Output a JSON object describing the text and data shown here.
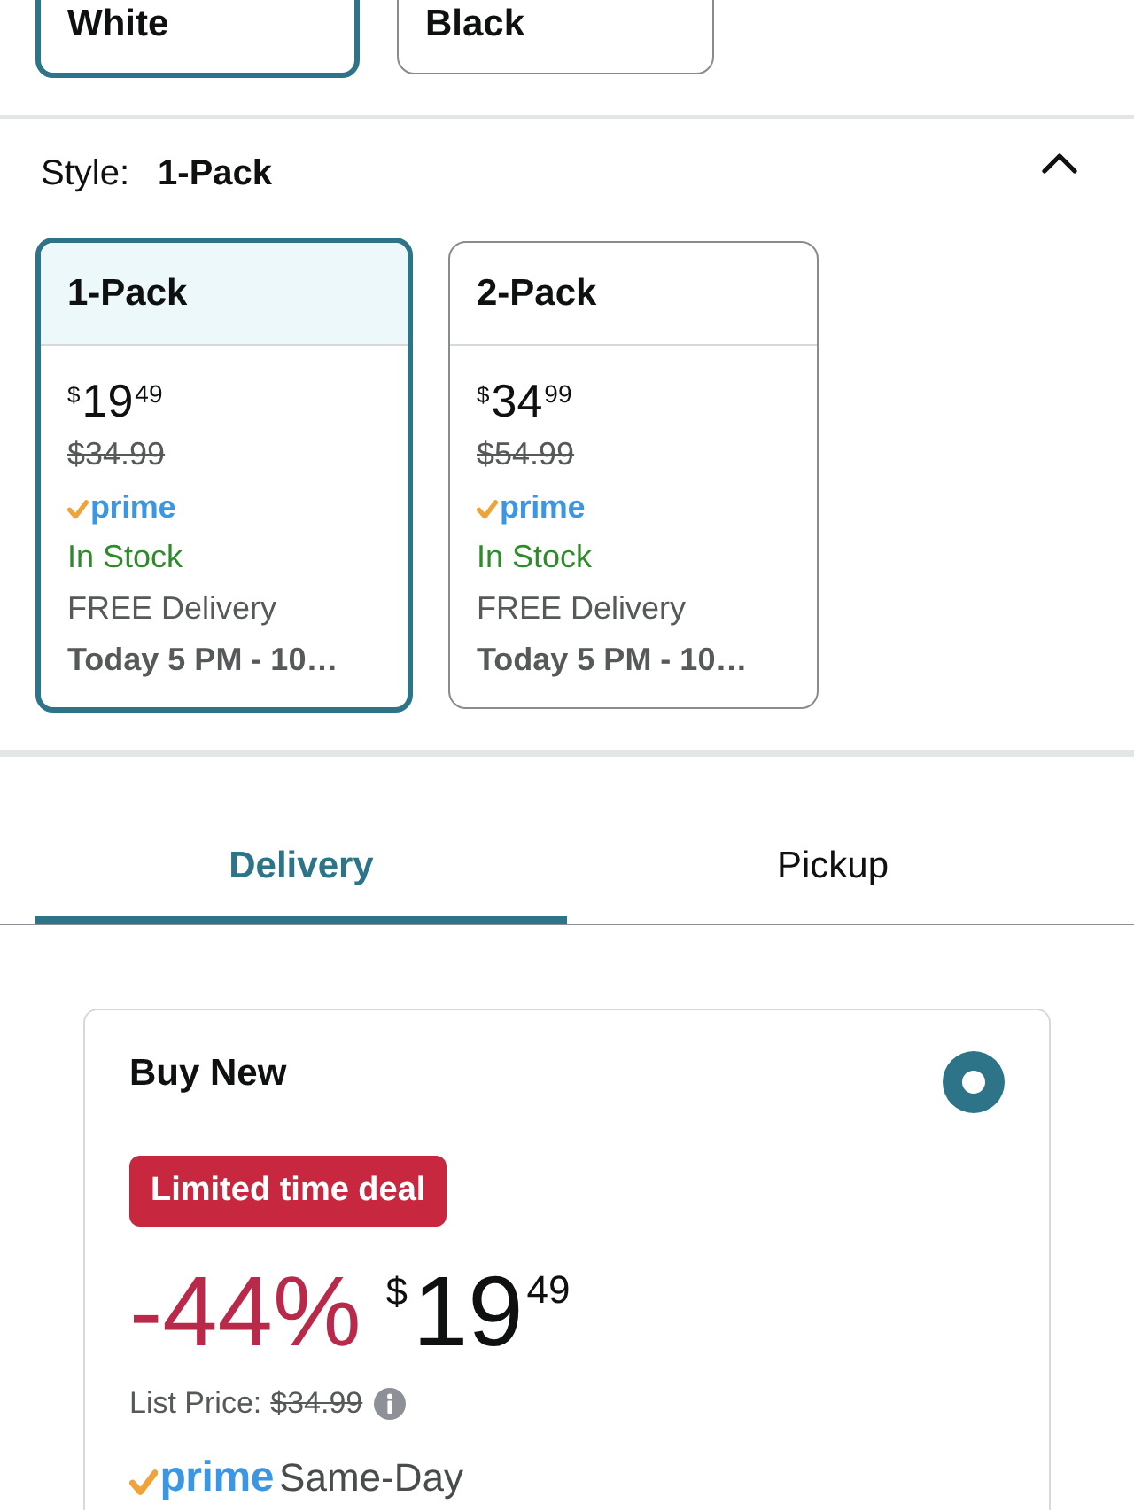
{
  "color_options": [
    {
      "label": "White",
      "selected": true
    },
    {
      "label": "Black",
      "selected": false
    }
  ],
  "style": {
    "label": "Style:",
    "value": "1-Pack",
    "expanded": true,
    "options": [
      {
        "name": "1-Pack",
        "selected": true,
        "price": {
          "currency": "$",
          "whole": "19",
          "fraction": "49"
        },
        "list_price": "$34.99",
        "prime": "prime",
        "availability": "In Stock",
        "delivery": "FREE Delivery",
        "delivery_time": "Today 5 PM - 10…"
      },
      {
        "name": "2-Pack",
        "selected": false,
        "price": {
          "currency": "$",
          "whole": "34",
          "fraction": "99"
        },
        "list_price": "$54.99",
        "prime": "prime",
        "availability": "In Stock",
        "delivery": "FREE Delivery",
        "delivery_time": "Today 5 PM - 10…"
      }
    ]
  },
  "tabs": [
    {
      "label": "Delivery",
      "selected": true
    },
    {
      "label": "Pickup",
      "selected": false
    }
  ],
  "offer": {
    "title": "Buy New",
    "selected": true,
    "deal_badge": "Limited time deal",
    "discount": "-44%",
    "price": {
      "currency": "$",
      "whole": "19",
      "fraction": "49"
    },
    "list_price_label": "List Price:",
    "list_price": "$34.99",
    "prime": "prime",
    "shipping": "Same-Day"
  }
}
